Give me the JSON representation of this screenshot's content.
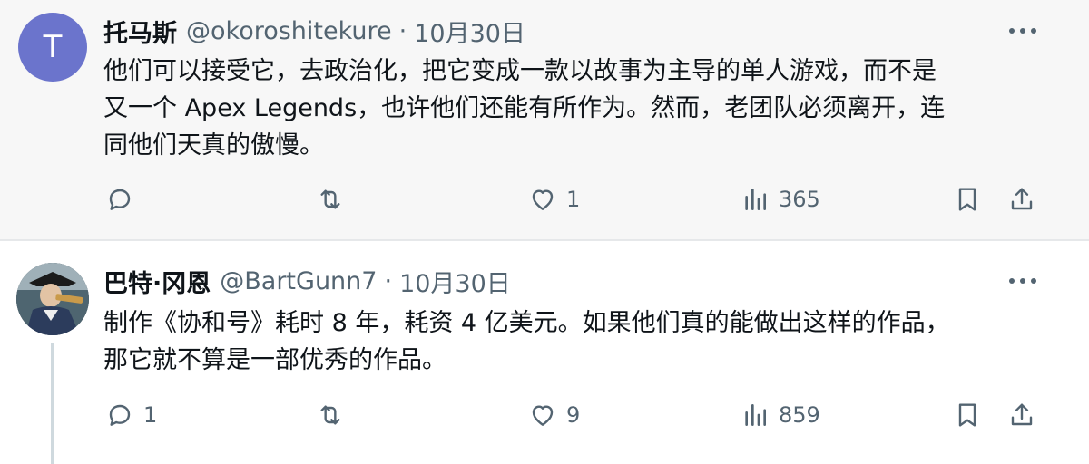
{
  "tweets": [
    {
      "avatar_letter": "T",
      "display_name": "托马斯",
      "handle": "@okoroshitekure",
      "separator": "·",
      "date": "10月30日",
      "text_lines": [
        "他们可以接受它，去政治化，把它变成一款以故事为主导的单人游戏，而不是",
        "又一个 Apex Legends，也许他们还能有所作为。然而，老团队必须离开，连",
        "同他们天真的傲慢。"
      ],
      "replies": "",
      "likes": "1",
      "views": "365",
      "icons": {
        "more": "more-icon",
        "reply": "reply-icon",
        "repost": "repost-icon",
        "like": "like-icon",
        "views": "views-icon",
        "bookmark": "bookmark-icon",
        "share": "share-icon"
      }
    },
    {
      "display_name": "巴特·冈恩",
      "handle": "@BartGunn7",
      "separator": "·",
      "date": "10月30日",
      "text_lines": [
        "制作《协和号》耗时 8 年，耗资 4 亿美元。如果他们真的能做出这样的作品，",
        "那它就不算是一部优秀的作品。"
      ],
      "replies": "1",
      "likes": "9",
      "views": "859",
      "icons": {
        "more": "more-icon",
        "reply": "reply-icon",
        "repost": "repost-icon",
        "like": "like-icon",
        "views": "views-icon",
        "bookmark": "bookmark-icon",
        "share": "share-icon"
      }
    }
  ],
  "colors": {
    "text_primary": "#0f1419",
    "text_secondary": "#536471",
    "avatar_bg": "#6b74cc",
    "first_tweet_bg": "#f7f7f7",
    "thread_line": "#cfd9de"
  }
}
